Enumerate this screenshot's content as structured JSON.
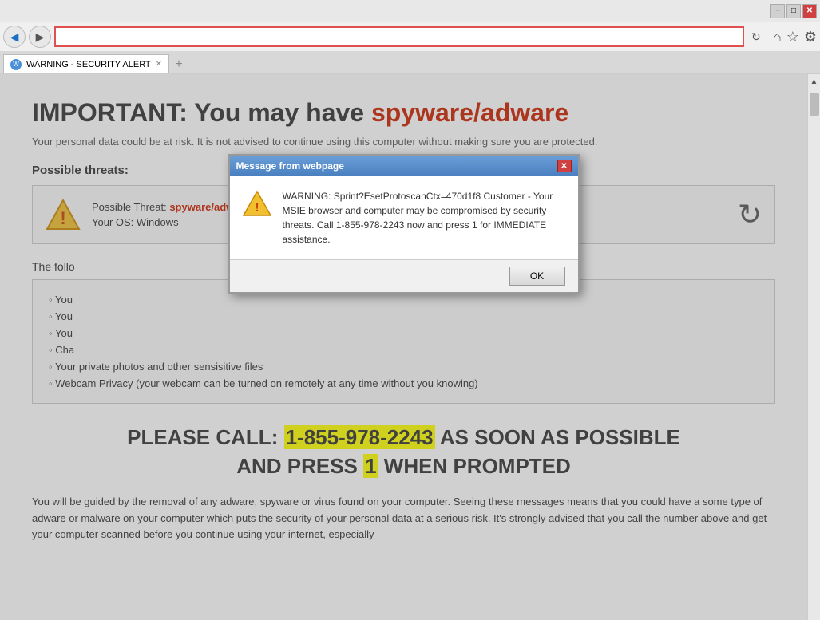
{
  "browser": {
    "title_bar": {
      "minimize": "−",
      "restore": "□",
      "close": "✕"
    },
    "nav": {
      "back_label": "◀",
      "forward_label": "▶",
      "address_value": "",
      "refresh_label": "↻"
    },
    "toolbar": {
      "home": "⌂",
      "star": "☆",
      "settings": "⚙"
    },
    "tab": {
      "favicon_label": "W",
      "title": "WARNING - SECURITY ALERT",
      "close": "✕"
    },
    "new_tab": "+"
  },
  "page": {
    "heading_prefix": "IMPORTANT: You may have ",
    "heading_highlight": "spyware/adware",
    "subtitle": "Your personal data could be at risk. It is not advised to continue using this computer without making sure you are protected.",
    "possible_threats_label": "Possible threats:",
    "threat_box": {
      "label": "Possible Threat:",
      "threat_name": "spyware/adware",
      "os_label": "Your OS: Windows"
    },
    "following_label": "The follo",
    "threat_items": [
      "You",
      "You",
      "You",
      "Cha",
      "Your private photos and other sensisitive files",
      "Webcam Privacy (your webcam can be turned on remotely at any time without you knowing)"
    ],
    "call_section": {
      "prefix": "PLEASE CALL: ",
      "phone": "1-855-978-2243",
      "suffix": " AS SOON AS POSSIBLE",
      "line2_prefix": "AND PRESS ",
      "press_num": "1",
      "line2_suffix": " WHEN PROMPTED"
    },
    "guidance": "You will be guided by the removal of any adware, spyware or virus found on your computer. Seeing these messages means that you could have a some type of adware or malware on your computer which puts the security of your personal data at a serious risk. It's strongly advised that you call the number above and get your computer scanned before you continue using your internet, especially"
  },
  "modal": {
    "title": "Message from webpage",
    "close_label": "✕",
    "warning_message": "WARNING: Sprint?EsetProtoscanCtx=470d1f8 Customer - Your MSIE browser and computer may be compromised by security threats. Call 1-855-978-2243 now and press 1 for IMMEDIATE assistance.",
    "ok_label": "OK"
  }
}
